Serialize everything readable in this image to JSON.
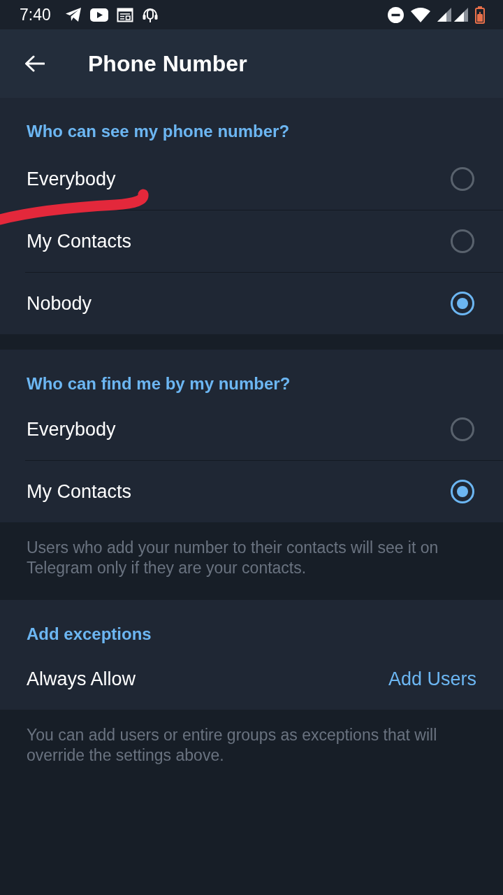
{
  "status_bar": {
    "time": "7:40"
  },
  "header": {
    "title": "Phone Number"
  },
  "sections": [
    {
      "title": "Who can see my phone number?",
      "items": [
        {
          "kind": "radio",
          "label": "Everybody",
          "selected": false
        },
        {
          "kind": "radio",
          "label": "My Contacts",
          "selected": false
        },
        {
          "kind": "radio",
          "label": "Nobody",
          "selected": true
        }
      ]
    },
    {
      "title": "Who can find me by my number?",
      "items": [
        {
          "kind": "radio",
          "label": "Everybody",
          "selected": false
        },
        {
          "kind": "radio",
          "label": "My Contacts",
          "selected": true
        }
      ],
      "hint": "Users who add your number to their contacts will see it on Telegram only if they are your contacts."
    },
    {
      "title": "Add exceptions",
      "items": [
        {
          "kind": "action",
          "label": "Always Allow",
          "action": "Add Users"
        }
      ],
      "hint": "You can add users or entire groups as exceptions that will override the settings above."
    }
  ]
}
